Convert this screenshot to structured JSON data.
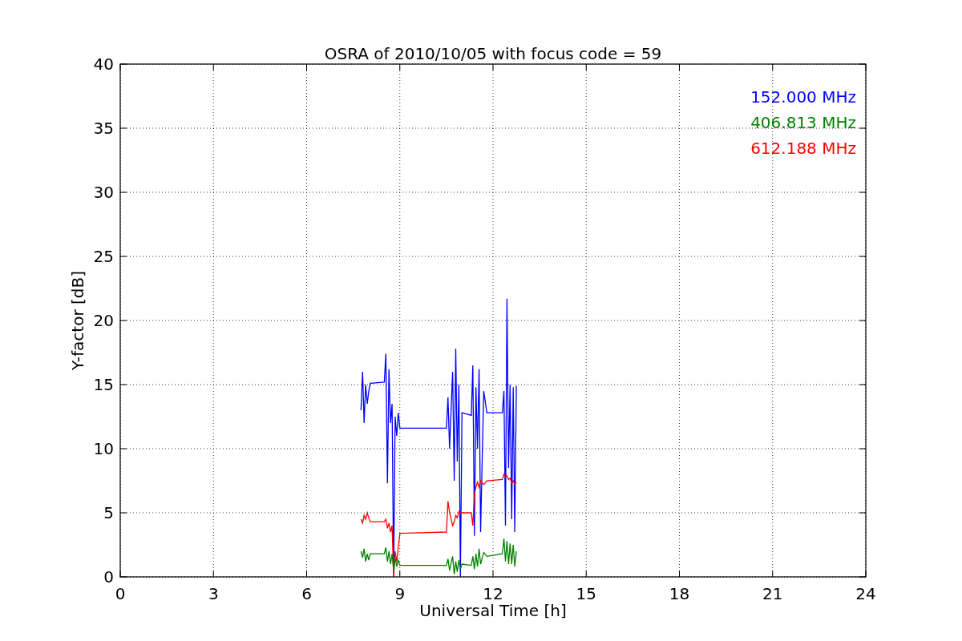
{
  "chart_data": {
    "type": "line",
    "title": "OSRA of 2010/10/05 with focus code = 59",
    "xlabel": "Universal Time [h]",
    "ylabel": "Y-factor [dB]",
    "x": [
      7.75,
      7.8,
      7.85,
      7.9,
      7.95,
      8.0,
      8.05,
      8.5,
      8.55,
      8.6,
      8.65,
      8.7,
      8.75,
      8.8,
      8.85,
      8.9,
      8.95,
      9.0,
      10.5,
      10.55,
      10.6,
      10.7,
      10.75,
      10.8,
      10.85,
      10.9,
      10.95,
      11.0,
      11.3,
      11.35,
      11.4,
      11.45,
      11.5,
      11.55,
      11.6,
      11.7,
      11.8,
      12.3,
      12.35,
      12.4,
      12.45,
      12.5,
      12.55,
      12.6,
      12.65,
      12.7,
      12.75
    ],
    "series": [
      {
        "name": "152.000 MHz",
        "color": "#0000ff",
        "values": [
          13,
          16,
          12,
          15,
          13.5,
          14.5,
          15.1,
          15.2,
          17.4,
          7.3,
          16.2,
          12,
          13.5,
          0,
          12.5,
          11,
          12.8,
          11.6,
          11.6,
          14,
          10,
          16,
          7.5,
          17.8,
          9,
          15,
          0,
          12.8,
          12.6,
          16.5,
          3.2,
          14.8,
          10,
          16.2,
          3.5,
          14.5,
          12.8,
          12.8,
          14.5,
          4,
          21.7,
          8.5,
          15,
          4.5,
          14.8,
          3.5,
          14.9
        ]
      },
      {
        "name": "406.813 MHz",
        "color": "#008000",
        "values": [
          2,
          1.5,
          2.2,
          1.2,
          1.8,
          1.3,
          1.8,
          1.8,
          2.3,
          1.2,
          2,
          1,
          1.8,
          0.5,
          1.5,
          0.8,
          1.3,
          0.9,
          0.9,
          1.4,
          0.5,
          1.6,
          0.2,
          1.2,
          0.4,
          1.3,
          0.6,
          1,
          0.9,
          1.6,
          0.6,
          1.8,
          0.8,
          2.2,
          1,
          1.9,
          1.6,
          1.8,
          3,
          1.2,
          2.8,
          1,
          2.6,
          1,
          2.5,
          0.8,
          2
        ]
      },
      {
        "name": "612.188 MHz",
        "color": "#ff0000",
        "values": [
          4.5,
          4.2,
          4.8,
          4.5,
          5,
          4.6,
          4.3,
          4.3,
          4.5,
          3.8,
          4.2,
          3.5,
          4,
          0,
          2,
          1.2,
          2.3,
          3.4,
          3.5,
          5.9,
          5,
          4,
          4.3,
          4.8,
          4.6,
          5.1,
          5,
          5,
          5,
          4,
          6.5,
          7,
          7.4,
          7,
          7.5,
          7.2,
          7.5,
          7.6,
          8,
          7.8,
          7.9,
          7.6,
          7.7,
          7.3,
          7.5,
          7.2,
          7.4
        ]
      }
    ],
    "grid": true,
    "xlim": [
      0,
      24
    ],
    "ylim": [
      0,
      40
    ],
    "xticks": [
      0,
      3,
      6,
      9,
      12,
      15,
      18,
      21,
      24
    ],
    "yticks": [
      0,
      5,
      10,
      15,
      20,
      25,
      30,
      35,
      40
    ]
  }
}
